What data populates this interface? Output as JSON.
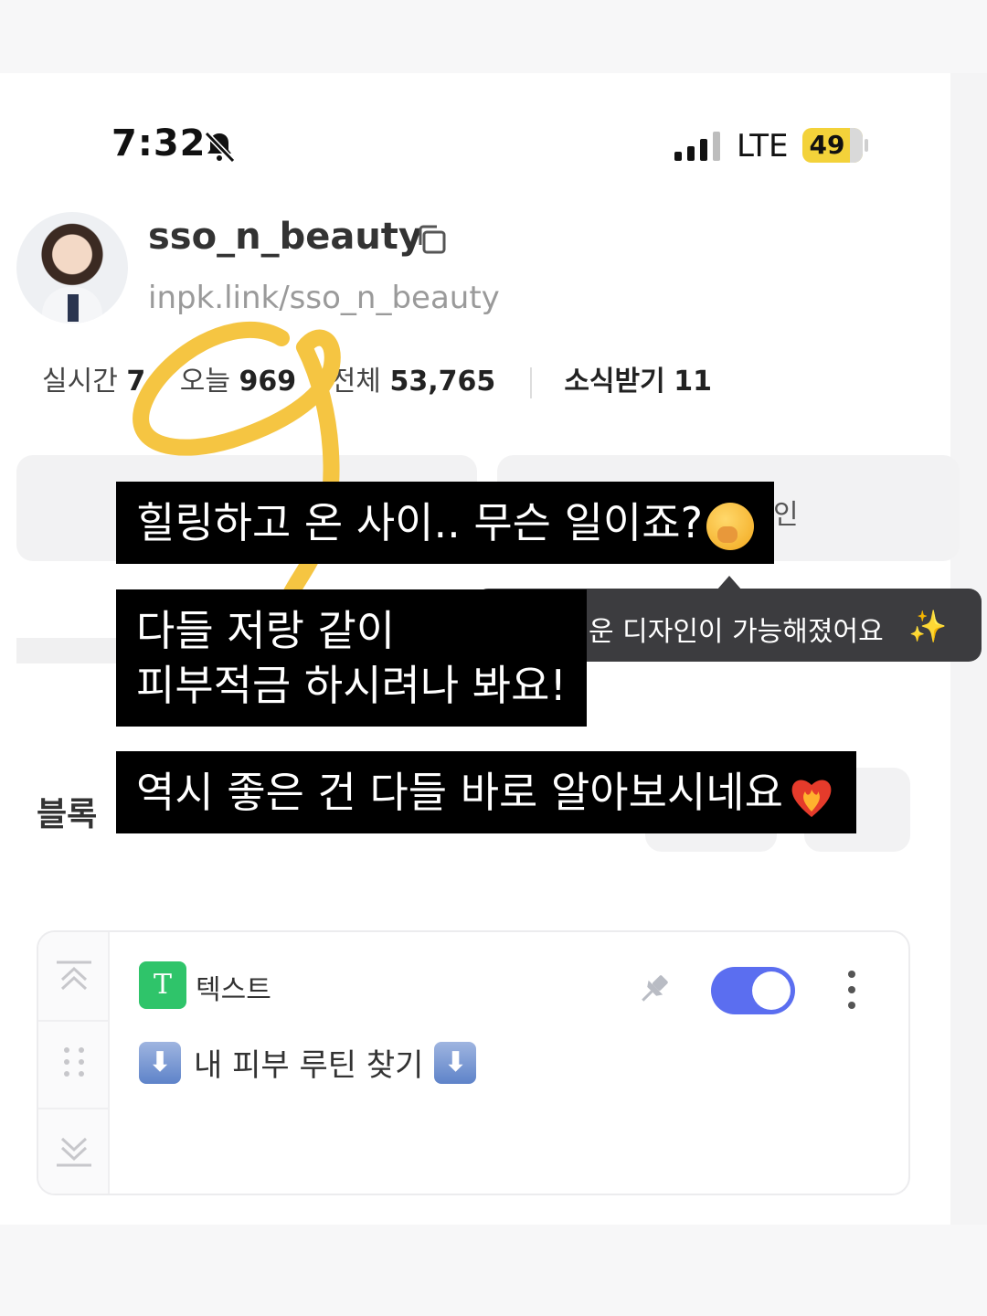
{
  "status_bar": {
    "time": "7:32",
    "network": "LTE",
    "battery": "49"
  },
  "profile": {
    "username": "sso_n_beauty",
    "link": "inpk.link/sso_n_beauty"
  },
  "stats": {
    "realtime_label": "실시간",
    "realtime_value": "7",
    "today_label": "오늘",
    "today_value": "969",
    "total_label": "전체",
    "total_value": "53,765",
    "subscribe_label": "소식받기",
    "subscribe_value": "11"
  },
  "partial": {
    "right_button_fragment": "인",
    "tooltip_text": "운 디자인이 가능해졌어요",
    "block_label_fragment": "블록"
  },
  "card": {
    "type_badge": "T",
    "type_label": "텍스트",
    "body_text": "내 피부 루틴 찾기",
    "arrow_glyph": "⬇",
    "toggle_on": true
  },
  "captions": {
    "line1": "힐링하고 온 사이.. 무슨 일이죠?",
    "line2a": "다들 저랑 같이",
    "line2b": "피부적금 하시려나 봐요!",
    "line3": "역시 좋은 건 다들 바로 알아보시네요"
  },
  "colors": {
    "accent_toggle": "#5b6ef0",
    "text_badge": "#2fc46a",
    "scribble": "#f5c542",
    "battery": "#f3d23a"
  },
  "icons": [
    "bell-slash-icon",
    "signal-icon",
    "copy-icon",
    "sparkle-icon",
    "chevron-up-icon",
    "grip-icon",
    "chevron-down-icon",
    "pin-icon",
    "more-vertical-icon",
    "arrow-down-icon",
    "shushing-face-emoji",
    "heart-on-fire-emoji"
  ]
}
